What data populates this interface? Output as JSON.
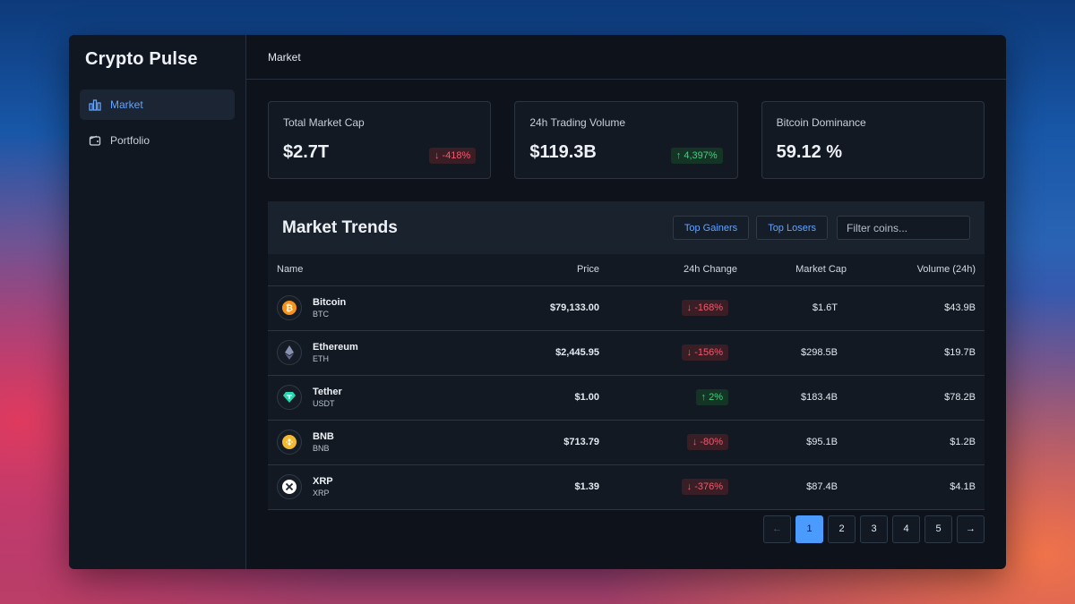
{
  "app": {
    "name": "Crypto Pulse"
  },
  "sidebar": {
    "items": [
      {
        "label": "Market",
        "icon": "bar-chart-icon",
        "active": true
      },
      {
        "label": "Portfolio",
        "icon": "wallet-icon",
        "active": false
      }
    ]
  },
  "header": {
    "title": "Market"
  },
  "stats": [
    {
      "label": "Total Market Cap",
      "value": "$2.7T",
      "change": "↓ -418%",
      "direction": "down"
    },
    {
      "label": "24h Trading Volume",
      "value": "$119.3B",
      "change": "↑ 4,397%",
      "direction": "up"
    },
    {
      "label": "Bitcoin Dominance",
      "value": "59.12 %",
      "change": "",
      "direction": ""
    }
  ],
  "trends": {
    "title": "Market Trends",
    "top_gainers": "Top Gainers",
    "top_losers": "Top Losers",
    "filter_placeholder": "Filter coins...",
    "columns": {
      "name": "Name",
      "price": "Price",
      "change": "24h Change",
      "market_cap": "Market Cap",
      "volume": "Volume (24h)"
    },
    "rows": [
      {
        "name": "Bitcoin",
        "symbol": "BTC",
        "price": "$79,133.00",
        "change": "↓ -168%",
        "direction": "down",
        "market_cap": "$1.6T",
        "volume": "$43.9B",
        "icon": "bitcoin-icon",
        "color": "#f7931a"
      },
      {
        "name": "Ethereum",
        "symbol": "ETH",
        "price": "$2,445.95",
        "change": "↓ -156%",
        "direction": "down",
        "market_cap": "$298.5B",
        "volume": "$19.7B",
        "icon": "ethereum-icon",
        "color": "#8a92b2"
      },
      {
        "name": "Tether",
        "symbol": "USDT",
        "price": "$1.00",
        "change": "↑ 2%",
        "direction": "up",
        "market_cap": "$183.4B",
        "volume": "$78.2B",
        "icon": "tether-icon",
        "color": "#26d9b0"
      },
      {
        "name": "BNB",
        "symbol": "BNB",
        "price": "$713.79",
        "change": "↓ -80%",
        "direction": "down",
        "market_cap": "$95.1B",
        "volume": "$1.2B",
        "icon": "bnb-icon",
        "color": "#f3ba2f"
      },
      {
        "name": "XRP",
        "symbol": "XRP",
        "price": "$1.39",
        "change": "↓ -376%",
        "direction": "down",
        "market_cap": "$87.4B",
        "volume": "$4.1B",
        "icon": "xrp-icon",
        "color": "#ffffff"
      }
    ]
  },
  "pagination": {
    "prev": "←",
    "pages": [
      "1",
      "2",
      "3",
      "4",
      "5"
    ],
    "current": "1",
    "next": "→"
  }
}
